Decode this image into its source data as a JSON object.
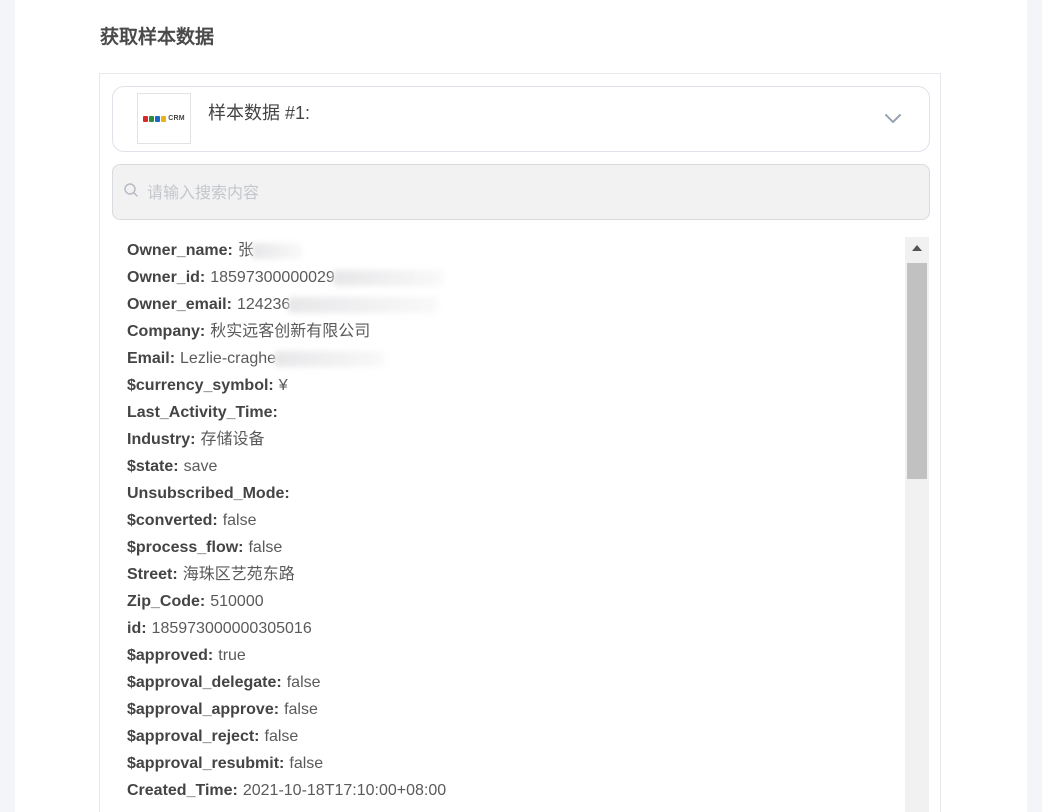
{
  "section": {
    "title": "获取样本数据"
  },
  "sample": {
    "title": "样本数据 #1:",
    "logo_text": "CRM",
    "logo_colors": [
      "#d62b2b",
      "#2f8b3c",
      "#1f66c2",
      "#e8b21a"
    ]
  },
  "search": {
    "placeholder": "请输入搜索内容",
    "value": ""
  },
  "fields": [
    {
      "key": "Owner_name:",
      "value": "张",
      "redacted": true
    },
    {
      "key": "Owner_id:",
      "value": "18597300000029",
      "redacted": true
    },
    {
      "key": "Owner_email:",
      "value": "124236",
      "redacted": true
    },
    {
      "key": "Company:",
      "value": "秋实远客创新有限公司"
    },
    {
      "key": "Email:",
      "value": "Lezlie-craghe",
      "redacted": true
    },
    {
      "key": "$currency_symbol:",
      "value": "¥"
    },
    {
      "key": "Last_Activity_Time:",
      "value": ""
    },
    {
      "key": "Industry:",
      "value": "存储设备"
    },
    {
      "key": "$state:",
      "value": "save"
    },
    {
      "key": "Unsubscribed_Mode:",
      "value": ""
    },
    {
      "key": "$converted:",
      "value": "false"
    },
    {
      "key": "$process_flow:",
      "value": "false"
    },
    {
      "key": "Street:",
      "value": "海珠区艺苑东路"
    },
    {
      "key": "Zip_Code:",
      "value": "510000"
    },
    {
      "key": "id:",
      "value": "185973000000305016"
    },
    {
      "key": "$approved:",
      "value": "true"
    },
    {
      "key": "$approval_delegate:",
      "value": "false"
    },
    {
      "key": "$approval_approve:",
      "value": "false"
    },
    {
      "key": "$approval_reject:",
      "value": "false"
    },
    {
      "key": "$approval_resubmit:",
      "value": "false"
    },
    {
      "key": "Created_Time:",
      "value": "2021-10-18T17:10:00+08:00"
    }
  ]
}
